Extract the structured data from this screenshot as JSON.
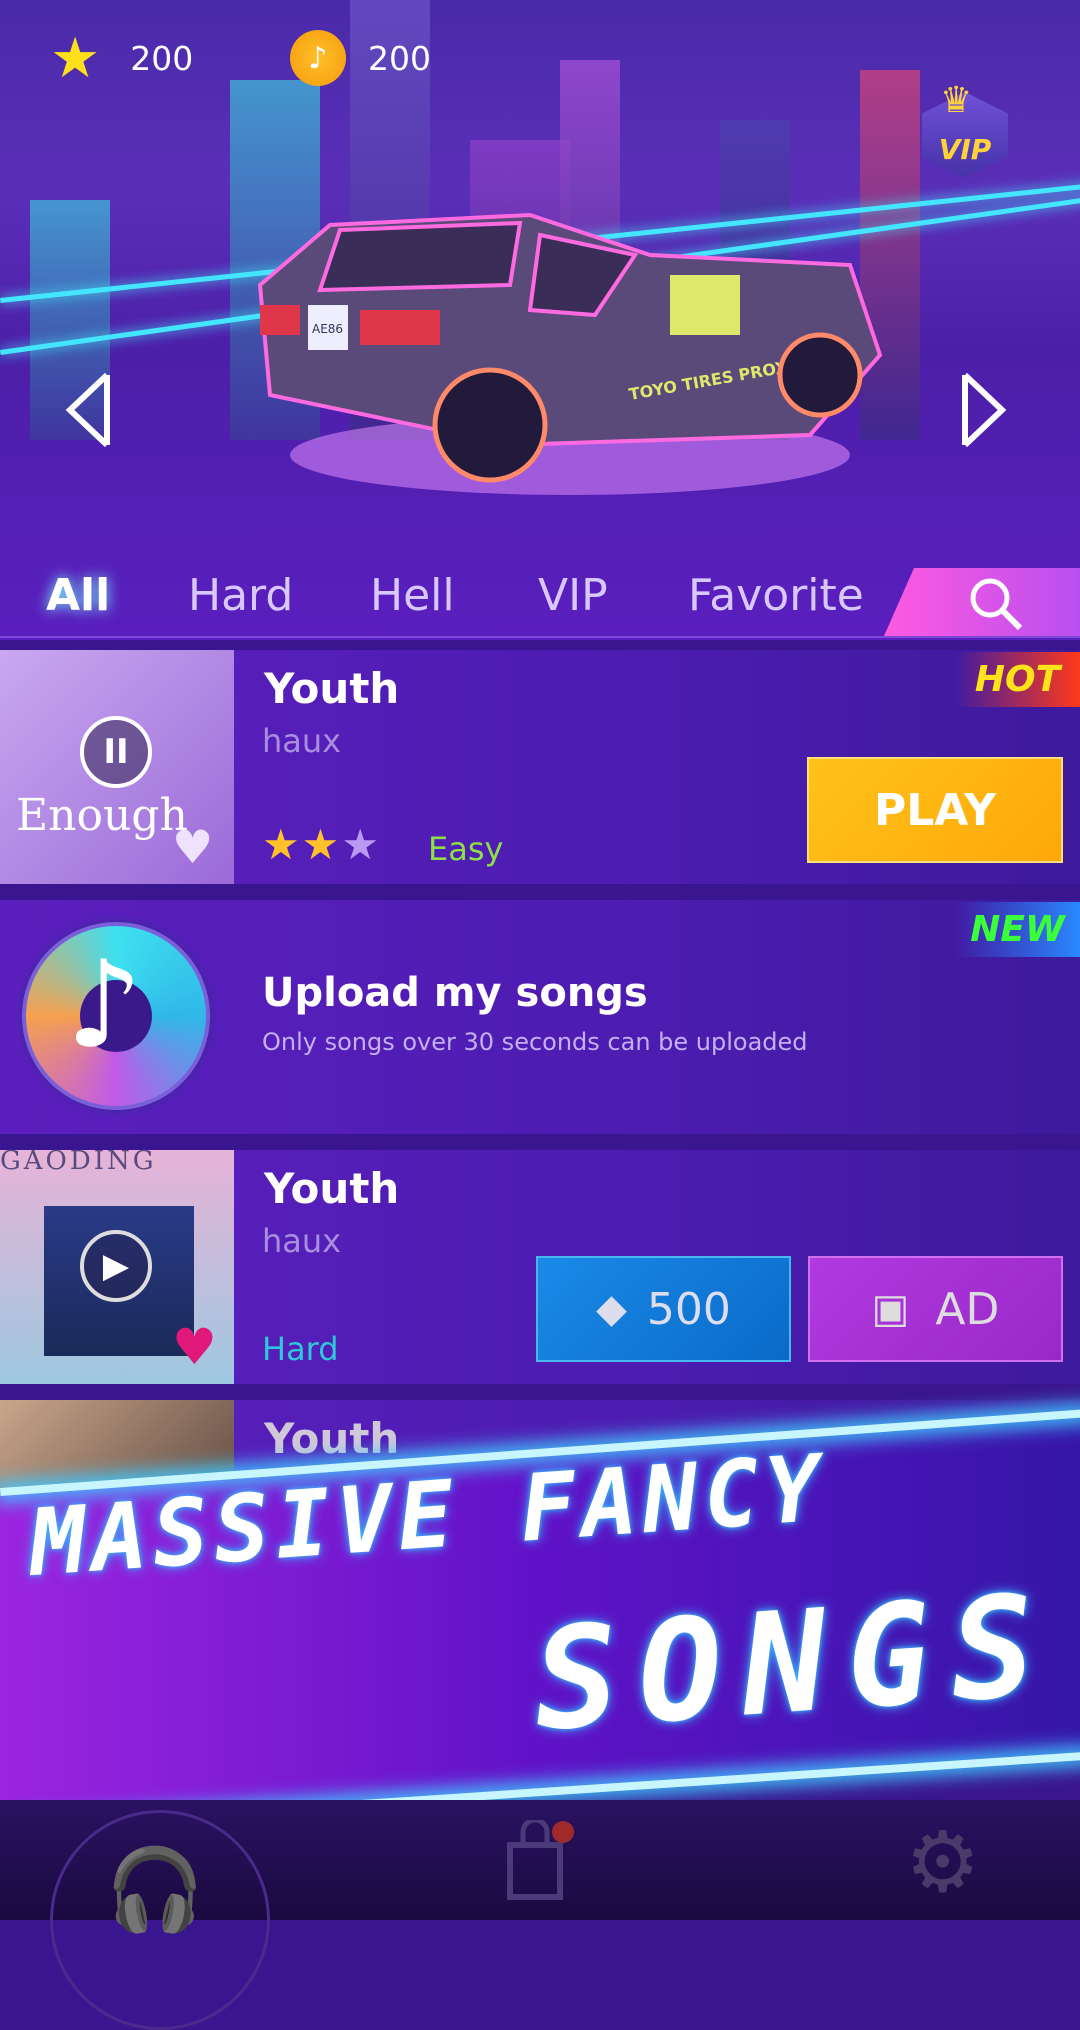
{
  "resources": {
    "stars": "200",
    "coins": "200"
  },
  "vip_badge": "VIP",
  "car": {
    "plate": "AE86",
    "decal": "TOYO TIRES PROXES"
  },
  "tabs": [
    {
      "label": "All",
      "active": true
    },
    {
      "label": "Hard"
    },
    {
      "label": "Hell"
    },
    {
      "label": "VIP"
    },
    {
      "label": "Favorite"
    }
  ],
  "songs": [
    {
      "title": "Youth",
      "artist": "haux",
      "difficulty": "Easy",
      "stars_filled": 2,
      "stars_total": 3,
      "badge": "HOT",
      "action": "PLAY",
      "album_text": "Enough",
      "state": "playing"
    },
    {
      "title": "Youth",
      "artist": "haux",
      "difficulty": "Hard",
      "price": "500",
      "ad_label": "AD",
      "album_text": "GAODING",
      "favorite": true
    },
    {
      "title": "Youth"
    }
  ],
  "upload": {
    "title": "Upload my songs",
    "subtitle": "Only songs over 30 seconds can be uploaded",
    "badge": "NEW"
  },
  "banner": {
    "line1": "MASSIVE FANCY",
    "line2": "SONGS"
  },
  "nav": [
    "headphones-icon",
    "shop-bag-icon",
    "settings-gear-icon"
  ],
  "colors": {
    "play": "#ffb20a",
    "gem_button": "#0a7fd8",
    "ad_button": "#a22fd0",
    "easy": "#8de04a",
    "hard": "#2ec8d8"
  }
}
